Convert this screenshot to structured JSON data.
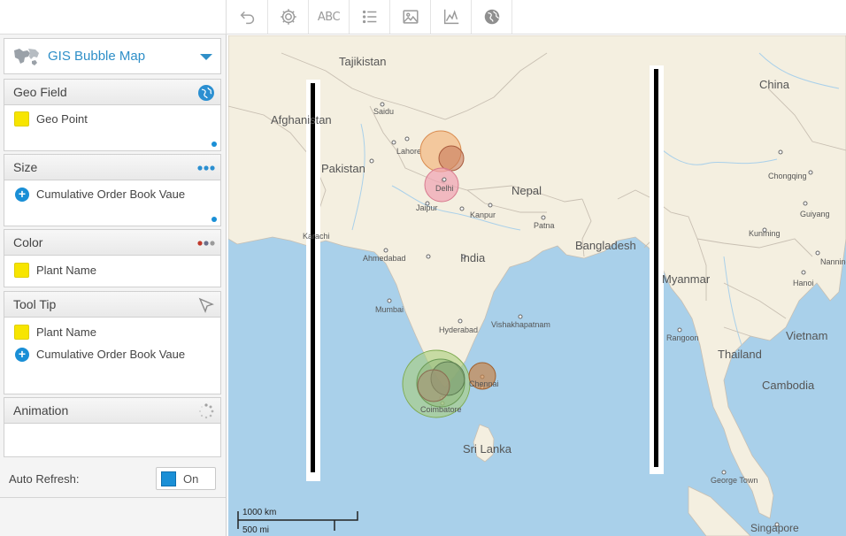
{
  "toolbar": {
    "abc_label": "ABC"
  },
  "panel": {
    "chart_type": "GIS Bubble Map",
    "sections": {
      "geo": {
        "title": "Geo Field",
        "fields": [
          "Geo Point"
        ]
      },
      "size": {
        "title": "Size",
        "fields": [
          "Cumulative Order Book Vaue"
        ]
      },
      "color": {
        "title": "Color",
        "fields": [
          "Plant Name"
        ]
      },
      "tooltip": {
        "title": "Tool Tip",
        "fields": [
          "Plant Name",
          "Cumulative Order Book Vaue"
        ]
      },
      "animation": {
        "title": "Animation"
      }
    },
    "auto_refresh": {
      "label": "Auto Refresh:",
      "state": "On"
    }
  },
  "map": {
    "countries": {
      "tajikistan": "Tajikistan",
      "afghanistan": "Afghanistan",
      "pakistan": "Pakistan",
      "nepal": "Nepal",
      "india": "India",
      "bangladesh": "Bangladesh",
      "china": "China",
      "myanmar": "Myanmar",
      "thailand": "Thailand",
      "vietnam": "Vietnam",
      "cambodia": "Cambodia",
      "sri_lanka": "Sri Lanka"
    },
    "cities": {
      "saidu": "Saidu",
      "lahore": "Lahore",
      "delhi": "Delhi",
      "jaipur": "Jaipur",
      "kanpur": "Kanpur",
      "patna": "Patna",
      "karachi": "Karachi",
      "ahmedabad": "Ahmedabad",
      "mumbai": "Mumbai",
      "hyderabad": "Hyderabad",
      "vishakhapatnam": "Vishakhapatnam",
      "chennai": "Chennai",
      "coimbatore": "Coimbatore",
      "chongqing": "Chongqing",
      "guiyang": "Guiyang",
      "kunming": "Kunming",
      "nanning": "Nanning",
      "hanoi": "Hanoi",
      "rangoon": "Rangoon",
      "george_town": "George Town",
      "singapore": "Singapore"
    },
    "scale": {
      "km": "1000 km",
      "mi": "500 mi"
    },
    "colors": {
      "land": "#f4efe0",
      "water": "#a9d0ea",
      "border": "#c8bfb2"
    }
  }
}
